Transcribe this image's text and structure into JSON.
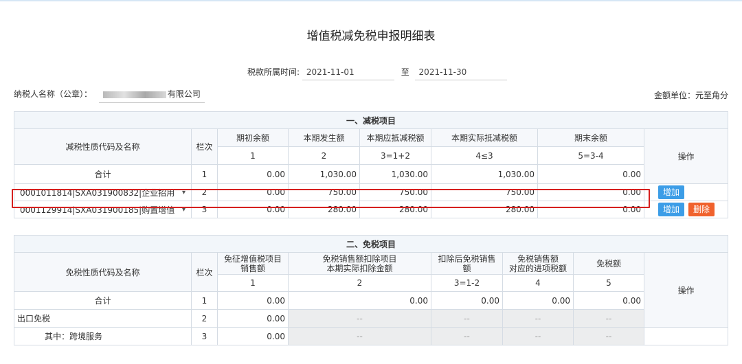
{
  "page": {
    "title": "增值税减免税申报明细表",
    "period_label": "税款所属时间:",
    "period_start": "2021-11-01",
    "period_to": "至",
    "period_end": "2021-11-30",
    "taxpayer_label": "纳税人名称（公章）：",
    "taxpayer_name_visible": "有限公司",
    "amount_unit": "金额单位：元至角分"
  },
  "reduction": {
    "section_title": "一、减税项目",
    "col_name": "减税性质代码及名称",
    "col_row": "栏次",
    "col_headers": [
      "期初余额",
      "本期发生额",
      "本期应抵减税额",
      "本期实际抵减税额",
      "期末余额"
    ],
    "col_nums": [
      "1",
      "2",
      "3=1+2",
      "4≤3",
      "5=3-4"
    ],
    "col_op": "操作",
    "rows": [
      {
        "name": "合计",
        "row": "1",
        "values": [
          "0.00",
          "1,030.00",
          "1,030.00",
          "1,030.00",
          "0.00"
        ]
      },
      {
        "name": "0001011814|SXA031900832|企业招用",
        "row": "2",
        "values": [
          "0.00",
          "750.00",
          "750.00",
          "750.00",
          "0.00"
        ],
        "btn_add": "增加"
      },
      {
        "name": "0001129914|SXA031900185|购置增值",
        "row": "3",
        "values": [
          "0.00",
          "280.00",
          "280.00",
          "280.00",
          "0.00"
        ],
        "btn_add": "增加",
        "btn_del": "删除"
      }
    ]
  },
  "exemption": {
    "section_title": "二、免税项目",
    "col_name": "免税性质代码及名称",
    "col_row": "栏次",
    "col_headers": [
      "免征增值税项目\n销售额",
      "免税销售额扣除项目\n本期实际扣除金额",
      "扣除后免税销售\n额",
      "免税销售额\n对应的进项税额",
      "免税额"
    ],
    "col_nums": [
      "1",
      "2",
      "3=1-2",
      "4",
      "5"
    ],
    "col_op": "操作",
    "rows": [
      {
        "name": "合计",
        "row": "1",
        "values": [
          "0.00",
          "0.00",
          "0.00",
          "0.00",
          "0.00"
        ]
      },
      {
        "name": "出口免税",
        "row": "2",
        "values": [
          "0.00",
          "--",
          "--",
          "--",
          "--"
        ]
      },
      {
        "name": "其中：跨境服务",
        "row": "3",
        "values": [
          "0.00",
          "--",
          "--",
          "--",
          "--"
        ]
      }
    ]
  }
}
